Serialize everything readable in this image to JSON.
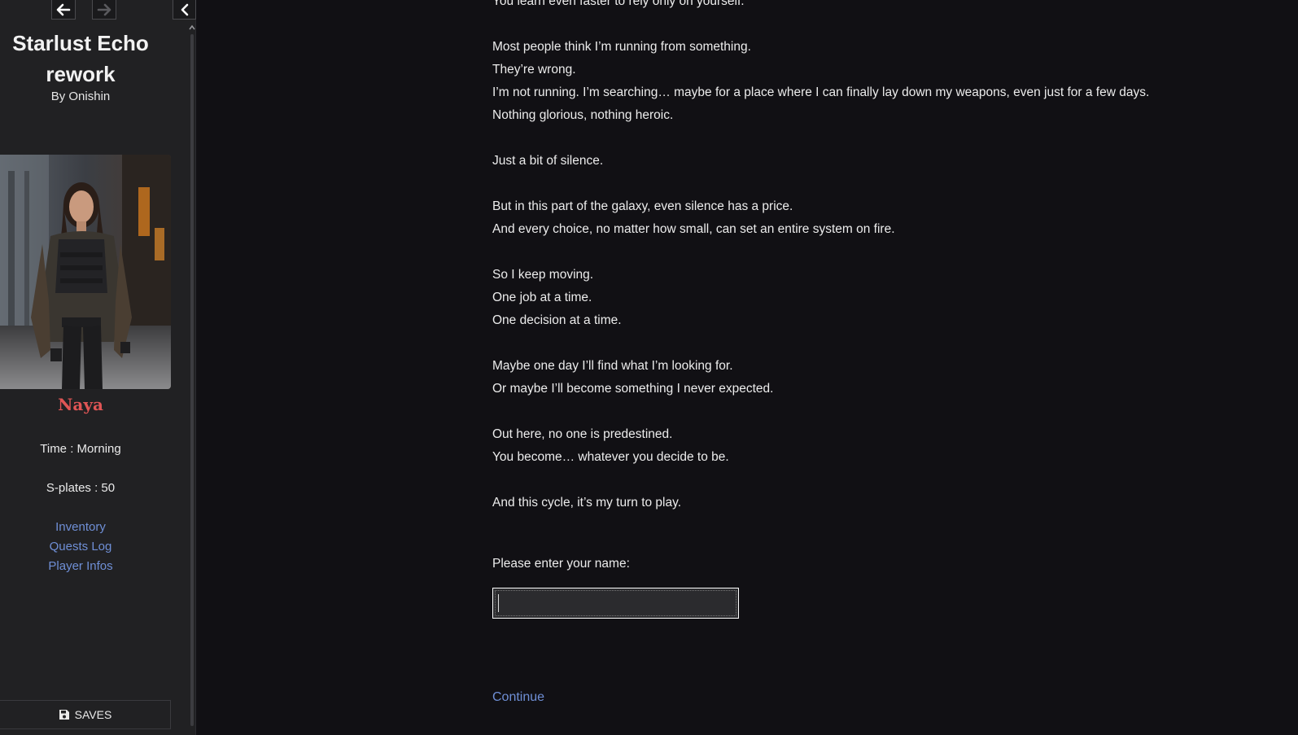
{
  "sidebar": {
    "title": "Starlust Echo rework",
    "author": "By Onishin",
    "character_name": "Naya",
    "stats": {
      "time": "Time : Morning",
      "splates": "S-plates : 50"
    },
    "links": {
      "inventory": "Inventory",
      "quests": "Quests Log",
      "player": "Player Infos"
    },
    "saves_label": "SAVES"
  },
  "story": {
    "paragraphs": [
      [
        "You learn even faster to rely only on yourself."
      ],
      [
        "Most people think I’m running from something.",
        "They’re wrong.",
        "I’m not running. I’m searching… maybe for a place where I can finally lay down my weapons, even just for a few days.",
        "Nothing glorious, nothing heroic."
      ],
      [
        "Just a bit of silence."
      ],
      [
        "But in this part of the galaxy, even silence has a price.",
        "And every choice, no matter how small, can set an entire system on fire."
      ],
      [
        "So I keep moving.",
        "One job at a time.",
        "One decision at a time."
      ],
      [
        "Maybe one day I’ll find what I’m looking for.",
        "Or maybe I’ll become something I never expected."
      ],
      [
        "Out here, no one is predestined.",
        "You become… whatever you decide to be."
      ],
      [
        "And this cycle, it’s my turn to play."
      ]
    ],
    "prompt": "Please enter your name:",
    "name_value": "",
    "continue_label": "Continue"
  },
  "colors": {
    "background": "#111014",
    "sidebar": "#212123",
    "link": "#6f8fd6",
    "character_name": "#e05555"
  },
  "icons": {
    "back": "arrow-left-icon",
    "forward": "arrow-right-icon",
    "toggle": "chevron-left-icon",
    "saves": "floppy-disk-icon"
  }
}
